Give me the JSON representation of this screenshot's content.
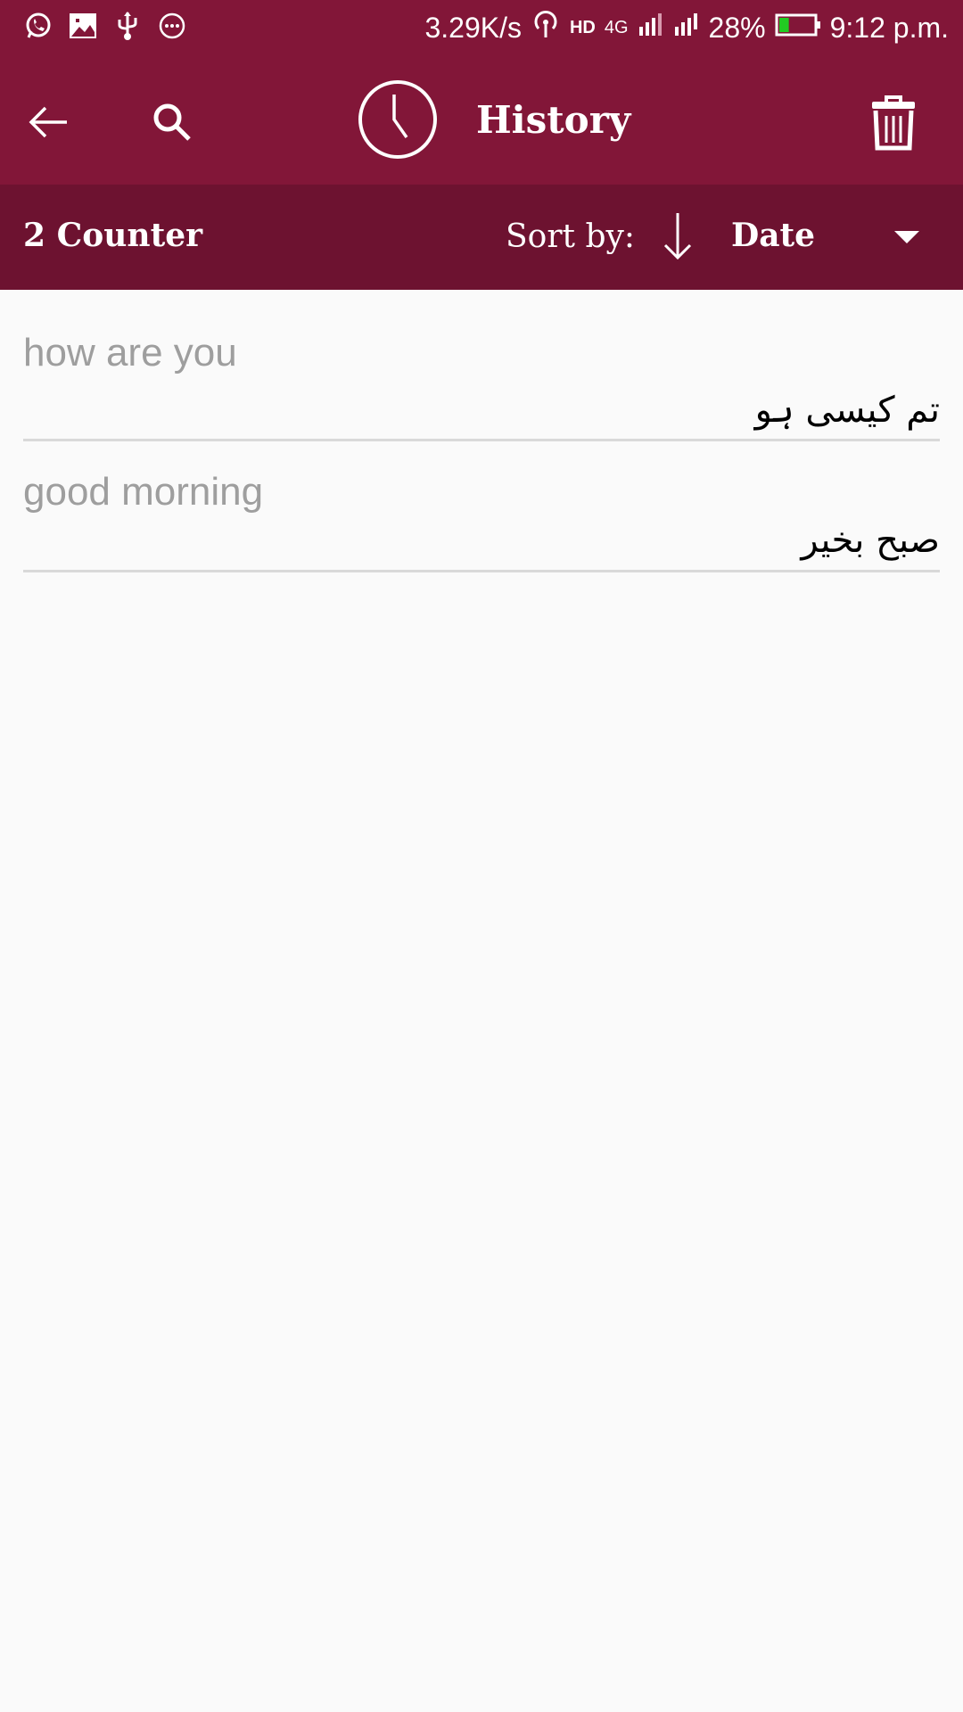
{
  "status_bar": {
    "notification_icons": [
      "whatsapp-icon",
      "image-icon",
      "usb-icon",
      "more-icon"
    ],
    "net_speed": "3.29K/s",
    "battery_percent": "28%",
    "battery_level": 0.28,
    "battery_color": "#22cc22",
    "time": "9:12 p.m.",
    "network": "4G",
    "hd_label": "HD",
    "sim1": "1",
    "sim2": "2"
  },
  "toolbar": {
    "title": "History",
    "back_icon": "arrow-left-icon",
    "search_icon": "search-icon",
    "title_icon": "clock-icon",
    "delete_icon": "trash-icon",
    "color": "#821638"
  },
  "subbar": {
    "counter": "2 Counter",
    "sort_label": "Sort by:",
    "sort_direction": "descending",
    "sort_value": "Date",
    "color": "#6d1230"
  },
  "history": [
    {
      "source": "how are you",
      "translation": "تم کیسی ہو"
    },
    {
      "source": "good morning",
      "translation": "صبح بخیر"
    }
  ]
}
